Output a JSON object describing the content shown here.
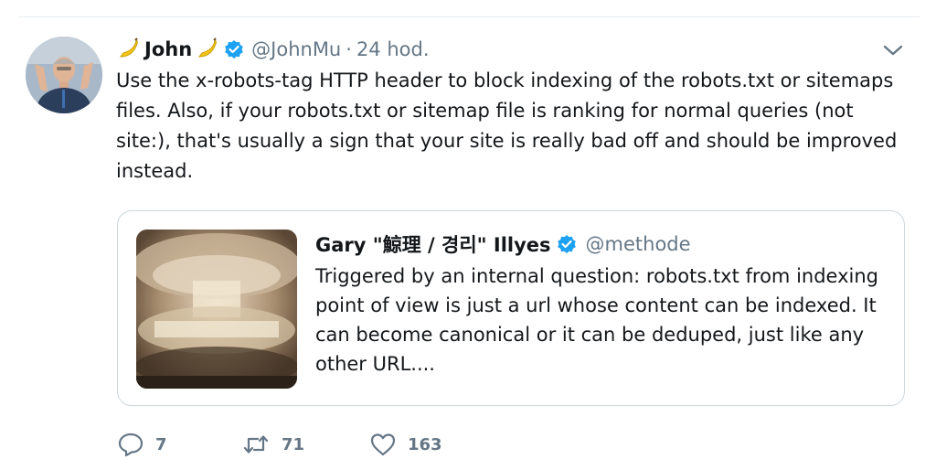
{
  "tweet": {
    "author_name": "John",
    "author_handle": "@JohnMu",
    "time": "24 hod.",
    "separator": "·",
    "text": "Use the x-robots-tag HTTP header to block indexing of the robots.txt or sitemaps files. Also, if your robots.txt or sitemap file is ranking for normal queries (not site:), that's usually a sign that your site is really bad off and should be improved instead."
  },
  "quote": {
    "author_name": "Gary \"鯨理 / 경리\" Illyes",
    "author_handle": "@methode",
    "text": "Triggered by an internal question: robots.txt from indexing point of view is just a url whose content can be indexed. It can become canonical or it can be deduped, just like any other URL...."
  },
  "actions": {
    "reply_count": "7",
    "retweet_count": "71",
    "like_count": "163"
  },
  "colors": {
    "verified": "#1da1f2",
    "muted": "#657786",
    "border": "#ccd6dd",
    "text": "#14171a"
  },
  "icons": {
    "name_emoji": "banana-icon",
    "verified": "verified-badge-icon",
    "menu": "chevron-down-icon",
    "reply": "reply-icon",
    "retweet": "retweet-icon",
    "like": "heart-icon"
  }
}
